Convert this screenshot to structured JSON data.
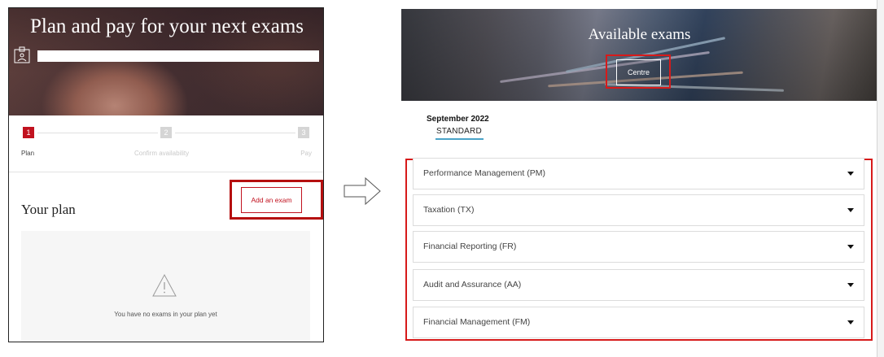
{
  "left": {
    "hero_title": "Plan and pay for your next exams",
    "steps": [
      {
        "number": "1",
        "label": "Plan",
        "active": true
      },
      {
        "number": "2",
        "label": "Confirm availability",
        "active": false
      },
      {
        "number": "3",
        "label": "Pay",
        "active": false
      }
    ],
    "plan_heading": "Your plan",
    "add_exam_label": "Add an exam",
    "empty_message": "You have no exams in your plan yet",
    "icons": {
      "document": "document-icon",
      "warning": "warning-icon"
    }
  },
  "right": {
    "hero_title": "Available exams",
    "centre_label": "Centre",
    "session_date": "September 2022",
    "session_type": "STANDARD",
    "exams": [
      {
        "name": "Performance Management (PM)"
      },
      {
        "name": "Taxation (TX)"
      },
      {
        "name": "Financial Reporting (FR)"
      },
      {
        "name": "Audit and Assurance (AA)"
      },
      {
        "name": "Financial Management (FM)"
      }
    ]
  },
  "colors": {
    "accent_red": "#c1121f",
    "highlight_red": "#d71a1a",
    "tab_underline": "#4aa3c7"
  }
}
